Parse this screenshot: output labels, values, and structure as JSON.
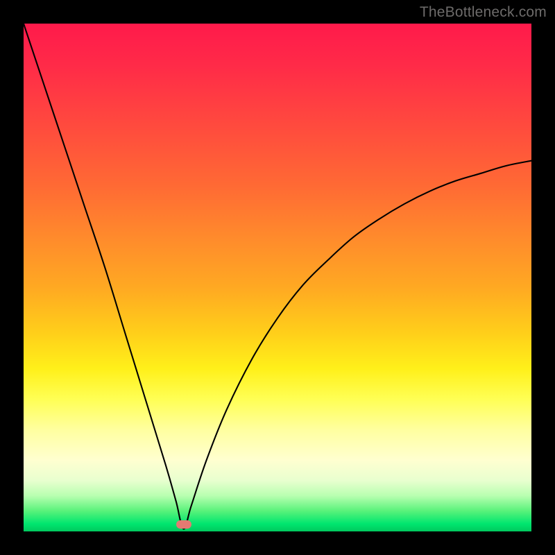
{
  "watermark": "TheBottleneck.com",
  "marker": {
    "x_pct": 31.5,
    "y_pct": 98.7
  },
  "colors": {
    "frame": "#000000",
    "curve": "#000000",
    "marker": "#e47a72",
    "watermark": "#6d6b6a"
  },
  "chart_data": {
    "type": "line",
    "title": "",
    "xlabel": "",
    "ylabel": "",
    "xlim": [
      0,
      100
    ],
    "ylim": [
      0,
      100
    ],
    "grid": false,
    "legend": false,
    "notes": "V-shaped bottleneck curve on red→green vertical gradient. Minimum (≈0) occurs near x≈32. Left branch nearly linear from (0,100) to minimum; right branch rises with diminishing slope toward ≈73 at x=100.",
    "series": [
      {
        "name": "bottleneck-curve",
        "x": [
          0,
          4,
          8,
          12,
          16,
          20,
          24,
          28,
          30,
          31.5,
          33,
          36,
          40,
          45,
          50,
          55,
          60,
          65,
          70,
          75,
          80,
          85,
          90,
          95,
          100
        ],
        "values": [
          100,
          88,
          76,
          64,
          52,
          39,
          26,
          13,
          6,
          0.5,
          5,
          14,
          24,
          34,
          42,
          48.5,
          53.5,
          58,
          61.5,
          64.5,
          67,
          69,
          70.5,
          72,
          73
        ]
      }
    ],
    "marker_point": {
      "x": 31.5,
      "y": 0.5
    }
  }
}
